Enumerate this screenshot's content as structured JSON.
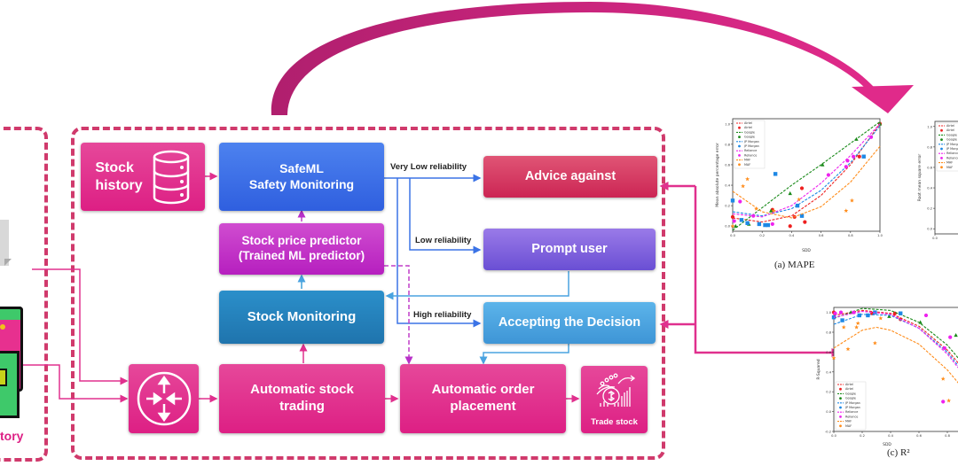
{
  "left_panel": {
    "label_partial": "tory"
  },
  "main_panel": {
    "stock_history": {
      "line1": "Stock",
      "line2": "history",
      "icon": "database-icon"
    },
    "safeml": {
      "line1": "SafeML",
      "line2": "Safety Monitoring"
    },
    "predictor": {
      "line1": "Stock price predictor",
      "line2": "(Trained ML predictor)"
    },
    "stock_monitoring": {
      "label": "Stock Monitoring"
    },
    "router": {
      "icon": "router-arrows-icon"
    },
    "auto_trading": {
      "line1": "Automatic stock",
      "line2": "trading"
    },
    "auto_order": {
      "line1": "Automatic order",
      "line2": "placement"
    },
    "trade_stock": {
      "label": "Trade stock",
      "icon": "trade-stock-icon"
    },
    "advice_against": {
      "label": "Advice against"
    },
    "prompt_user": {
      "label": "Prompt user"
    },
    "accepting": {
      "label": "Accepting the Decision"
    },
    "edges": {
      "very_low": "Very Low reliability",
      "low": "Low reliability",
      "high": "High reliability"
    }
  },
  "colors": {
    "accent_pink": "#dd1f84",
    "dashed_border": "#d03a6c",
    "arc_arrow": "#c8227f",
    "safeml_blue": "#3a6ce6",
    "predictor_magenta": "#c232c6",
    "monitoring_teal": "#2582bf",
    "advice_red": "#d63862",
    "prompt_purple": "#7c5fdd",
    "accept_sky": "#4aa3e0"
  },
  "chart_data": [
    {
      "type": "scatter",
      "title": "",
      "caption": "(a) MAPE",
      "xlabel": "SDD",
      "ylabel": "Mean absolute percentage error",
      "xlim": [
        0.0,
        1.0
      ],
      "ylim": [
        -0.05,
        1.05
      ],
      "xticks": [
        "0.0",
        "0.2",
        "0.4",
        "0.6",
        "0.8",
        "1.0"
      ],
      "yticks": [
        "0.0",
        "0.2",
        "0.4",
        "0.6",
        "0.8",
        "1.0"
      ],
      "legend_position": "top-left",
      "legend": [
        "Airtel",
        "Airtel",
        "Google",
        "Google",
        "JP Morgan",
        "JP Morgan",
        "Reliance",
        "Reliance",
        "MAF",
        "MAF"
      ],
      "series": [
        {
          "name": "Airtel",
          "color": "#ee2020",
          "marker": "circle",
          "points": [
            [
              0.0,
              0.09
            ],
            [
              0.27,
              0.16
            ],
            [
              0.39,
              0.0
            ],
            [
              0.42,
              0.09
            ],
            [
              0.47,
              0.37
            ],
            [
              0.49,
              0.04
            ],
            [
              0.86,
              0.68
            ],
            [
              1.0,
              1.0
            ]
          ],
          "fit": [
            [
              0.0,
              0.08
            ],
            [
              0.2,
              0.04
            ],
            [
              0.4,
              0.1
            ],
            [
              0.6,
              0.3
            ],
            [
              0.8,
              0.6
            ],
            [
              1.0,
              1.0
            ]
          ]
        },
        {
          "name": "Google",
          "color": "#1a8a1a",
          "marker": "triangle",
          "points": [
            [
              0.02,
              0.0
            ],
            [
              0.11,
              0.02
            ],
            [
              0.26,
              0.15
            ],
            [
              0.39,
              0.32
            ],
            [
              0.61,
              0.6
            ],
            [
              0.84,
              0.85
            ],
            [
              1.0,
              1.0
            ]
          ],
          "fit": [
            [
              0.0,
              -0.04
            ],
            [
              0.2,
              0.18
            ],
            [
              0.4,
              0.4
            ],
            [
              0.6,
              0.6
            ],
            [
              0.8,
              0.81
            ],
            [
              1.0,
              1.02
            ]
          ]
        },
        {
          "name": "JP Morgan",
          "color": "#1e88e5",
          "marker": "square",
          "points": [
            [
              0.0,
              0.25
            ],
            [
              0.06,
              0.06
            ],
            [
              0.1,
              0.03
            ],
            [
              0.18,
              0.02
            ],
            [
              0.22,
              0.01
            ],
            [
              0.24,
              0.01
            ],
            [
              0.29,
              0.51
            ],
            [
              0.44,
              0.2
            ],
            [
              0.47,
              0.1
            ],
            [
              0.89,
              0.68
            ]
          ],
          "fit": [
            [
              0.0,
              0.14
            ],
            [
              0.2,
              0.1
            ],
            [
              0.4,
              0.17
            ],
            [
              0.6,
              0.35
            ],
            [
              0.8,
              0.62
            ],
            [
              1.0,
              0.98
            ]
          ]
        },
        {
          "name": "Reliance",
          "color": "#ee22ee",
          "marker": "circle",
          "points": [
            [
              0.01,
              0.05
            ],
            [
              0.05,
              0.24
            ],
            [
              0.14,
              0.1
            ],
            [
              0.27,
              0.02
            ],
            [
              0.65,
              0.5
            ],
            [
              0.77,
              0.58
            ],
            [
              0.78,
              0.64
            ],
            [
              0.82,
              0.68
            ],
            [
              0.94,
              0.87
            ]
          ],
          "fit": [
            [
              0.0,
              0.12
            ],
            [
              0.2,
              0.09
            ],
            [
              0.4,
              0.2
            ],
            [
              0.6,
              0.42
            ],
            [
              0.8,
              0.69
            ],
            [
              1.0,
              1.0
            ]
          ]
        },
        {
          "name": "MAF",
          "color": "#ff8c1a",
          "marker": "star",
          "points": [
            [
              0.0,
              0.0
            ],
            [
              0.07,
              0.39
            ],
            [
              0.1,
              0.46
            ],
            [
              0.16,
              0.17
            ],
            [
              0.28,
              0.15
            ],
            [
              0.45,
              0.26
            ],
            [
              0.77,
              0.15
            ],
            [
              0.81,
              0.25
            ]
          ],
          "fit": [
            [
              0.0,
              0.34
            ],
            [
              0.2,
              0.14
            ],
            [
              0.4,
              0.08
            ],
            [
              0.6,
              0.19
            ],
            [
              0.8,
              0.43
            ],
            [
              1.0,
              0.78
            ]
          ]
        }
      ]
    },
    {
      "type": "scatter",
      "title": "",
      "caption": "(c) R²",
      "xlabel": "SDD",
      "ylabel": "R-Squared",
      "xlim": [
        0.0,
        1.0
      ],
      "ylim": [
        -0.2,
        1.05
      ],
      "xticks": [
        "0.0",
        "0.2",
        "0.4",
        "0.6",
        "0.8"
      ],
      "yticks": [
        "-0.2",
        "0.0",
        "0.2",
        "0.4",
        "0.6",
        "0.8",
        "1.0"
      ],
      "legend_position": "bottom-left",
      "legend": [
        "Airtel",
        "Airtel",
        "Google",
        "Google",
        "JP Morgan",
        "JP Morgan",
        "Reliance",
        "Reliance",
        "MAF",
        "MAF"
      ],
      "series": [
        {
          "name": "Airtel",
          "color": "#ee2020",
          "marker": "circle",
          "points": [
            [
              0.0,
              1.0
            ],
            [
              0.27,
              0.99
            ],
            [
              0.43,
              0.99
            ],
            [
              0.47,
              0.93
            ]
          ],
          "fit": [
            [
              0.0,
              0.97
            ],
            [
              0.2,
              1.02
            ],
            [
              0.4,
              0.99
            ],
            [
              0.6,
              0.86
            ],
            [
              0.8,
              0.62
            ],
            [
              0.9,
              0.45
            ]
          ]
        },
        {
          "name": "Google",
          "color": "#1a8a1a",
          "marker": "triangle",
          "points": [
            [
              0.12,
              1.0
            ],
            [
              0.39,
              0.96
            ],
            [
              0.61,
              0.9
            ],
            [
              0.86,
              0.77
            ]
          ],
          "fit": [
            [
              0.0,
              0.94
            ],
            [
              0.2,
              1.04
            ],
            [
              0.4,
              1.02
            ],
            [
              0.6,
              0.9
            ],
            [
              0.8,
              0.67
            ],
            [
              0.9,
              0.5
            ]
          ]
        },
        {
          "name": "JP Morgan",
          "color": "#1e88e5",
          "marker": "square",
          "points": [
            [
              0.0,
              0.95
            ],
            [
              0.06,
              0.92
            ],
            [
              0.18,
              0.97
            ],
            [
              0.24,
              0.97
            ],
            [
              0.29,
              1.0
            ],
            [
              0.47,
              0.99
            ]
          ],
          "fit": [
            [
              0.0,
              0.88
            ],
            [
              0.2,
              0.98
            ],
            [
              0.4,
              0.97
            ],
            [
              0.6,
              0.84
            ],
            [
              0.8,
              0.6
            ],
            [
              0.9,
              0.42
            ]
          ]
        },
        {
          "name": "Reliance",
          "color": "#ee22ee",
          "marker": "circle",
          "points": [
            [
              0.01,
              0.99
            ],
            [
              0.05,
              1.0
            ],
            [
              0.14,
              1.0
            ],
            [
              0.65,
              0.97
            ],
            [
              0.77,
              0.1
            ],
            [
              0.78,
              0.64
            ],
            [
              0.82,
              0.75
            ]
          ],
          "fit": [
            [
              0.0,
              0.95
            ],
            [
              0.2,
              1.01
            ],
            [
              0.4,
              0.98
            ],
            [
              0.6,
              0.84
            ],
            [
              0.8,
              0.58
            ],
            [
              0.9,
              0.4
            ]
          ]
        },
        {
          "name": "MAF",
          "color": "#ff8c1a",
          "marker": "star",
          "points": [
            [
              0.0,
              0.54
            ],
            [
              0.07,
              0.85
            ],
            [
              0.1,
              0.63
            ],
            [
              0.16,
              0.85
            ],
            [
              0.17,
              0.89
            ],
            [
              0.29,
              0.69
            ],
            [
              0.33,
              0.94
            ],
            [
              0.77,
              0.33
            ],
            [
              0.81,
              0.11
            ]
          ],
          "fit": [
            [
              0.0,
              0.64
            ],
            [
              0.2,
              0.82
            ],
            [
              0.3,
              0.85
            ],
            [
              0.4,
              0.82
            ],
            [
              0.6,
              0.68
            ],
            [
              0.8,
              0.42
            ],
            [
              0.9,
              0.25
            ]
          ]
        }
      ]
    },
    {
      "type": "scatter",
      "title": "",
      "caption": "",
      "xlabel": "",
      "ylabel": "Root mean square error",
      "xlim": [
        0.0,
        1.0
      ],
      "ylim": [
        -0.05,
        1.05
      ],
      "xticks": [
        "0.0"
      ],
      "yticks": [
        "0.0",
        "0.2",
        "0.4",
        "0.6",
        "0.8",
        "1.0"
      ],
      "legend_position": "top-left",
      "legend": [
        "Airtel",
        "Airtel",
        "Google",
        "Google",
        "JP Morgan",
        "JP Morgan",
        "Reliance",
        "Reliance",
        "MAF",
        "MAF"
      ],
      "partially_visible": true
    }
  ]
}
